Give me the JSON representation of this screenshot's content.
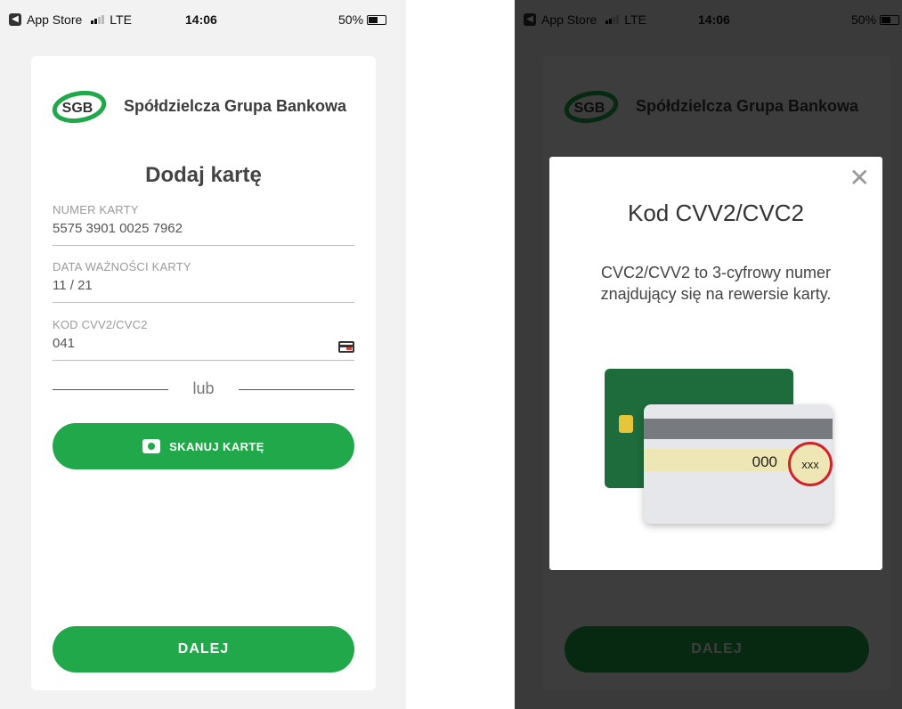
{
  "status_bar": {
    "back_label": "App Store",
    "network": "LTE",
    "time": "14:06",
    "battery": "50%"
  },
  "brand": {
    "logo_text": "SGB",
    "name": "Spółdzielcza Grupa Bankowa",
    "accent_color": "#21a84a"
  },
  "form": {
    "title": "Dodaj kartę",
    "card_number": {
      "label": "NUMER KARTY",
      "value": "5575 3901 0025 7962"
    },
    "expiry": {
      "label": "DATA WAŻNOŚCI KARTY",
      "value": "11 / 21"
    },
    "cvv": {
      "label": "KOD CVV2/CVC2",
      "value": "041",
      "icon": "card-back-icon"
    },
    "divider_text": "lub",
    "scan_button": "SKANUJ KARTĘ",
    "next_button": "DALEJ"
  },
  "modal": {
    "title": "Kod CVV2/CVC2",
    "description": "CVC2/CVV2 to 3-cyfrowy numer znajdujący się na rewersie karty.",
    "close_icon": "close-icon",
    "illustration": {
      "number": "000",
      "cvv": "xxx"
    }
  }
}
